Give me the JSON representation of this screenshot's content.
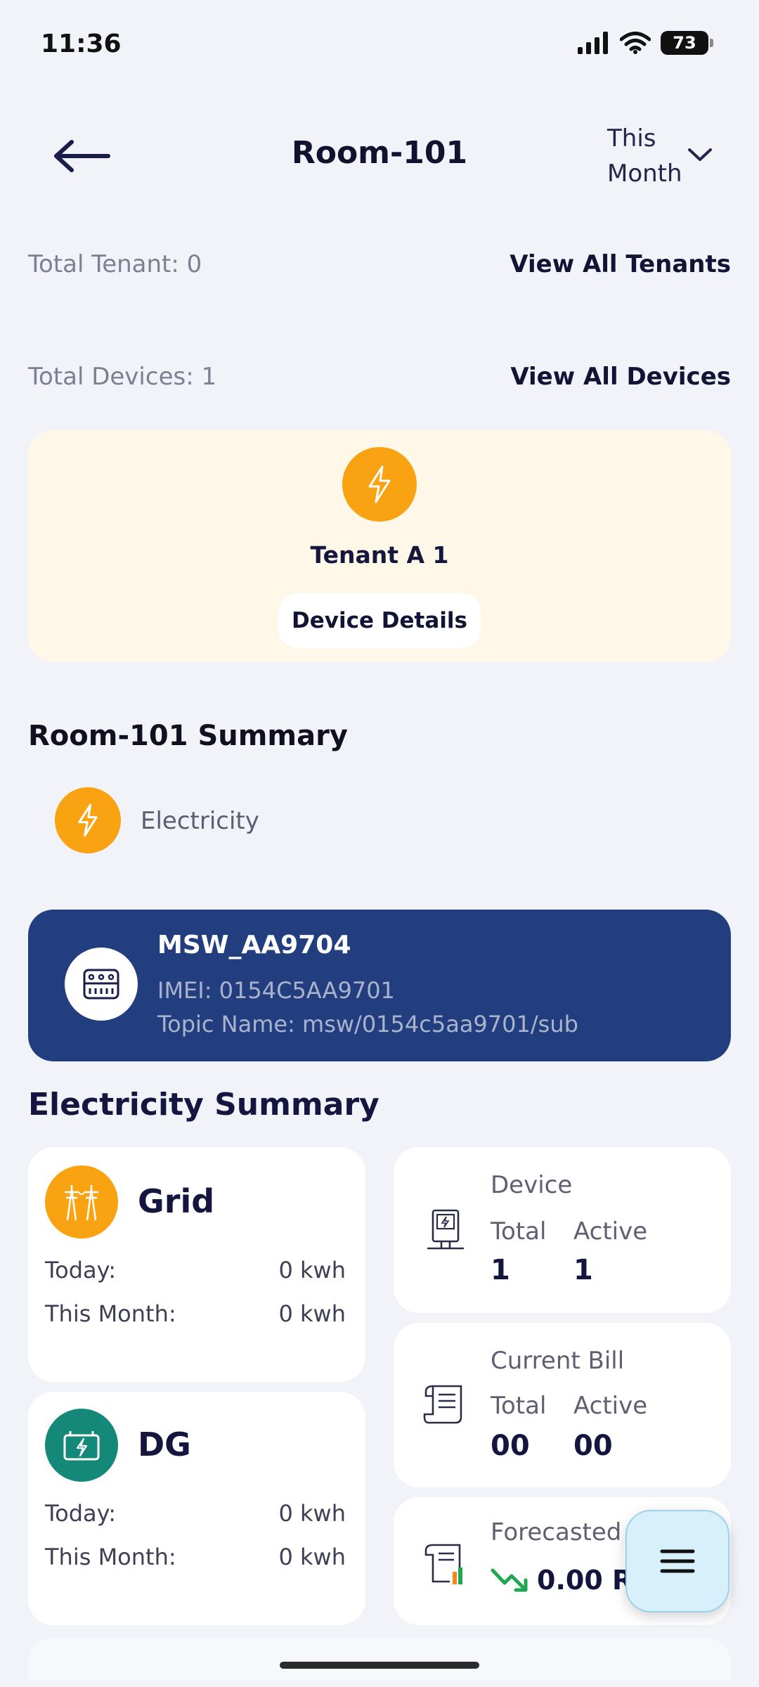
{
  "status": {
    "time": "11:36",
    "battery": "73"
  },
  "header": {
    "title": "Room-101",
    "period_line1": "This",
    "period_line2": "Month"
  },
  "tenants": {
    "label": "Total Tenant: 0",
    "link": "View All Tenants"
  },
  "devices": {
    "label": "Total Devices: 1",
    "link": "View All Devices"
  },
  "tenant_card": {
    "name": "Tenant A 1",
    "button": "Device Details"
  },
  "summary": {
    "title": "Room-101 Summary",
    "utility": "Electricity"
  },
  "device": {
    "name": "MSW_AA9704",
    "imei": "IMEI: 0154C5AA9701",
    "topic": "Topic Name: msw/0154c5aa9701/sub"
  },
  "electricity": {
    "title": "Electricity Summary",
    "grid": {
      "title": "Grid",
      "today_label": "Today:",
      "today_value": "0 kwh",
      "month_label": "This Month:",
      "month_value": "0 kwh"
    },
    "dg": {
      "title": "DG",
      "today_label": "Today:",
      "today_value": "0 kwh",
      "month_label": "This Month:",
      "month_value": "0 kwh"
    },
    "device_stat": {
      "title": "Device",
      "total_label": "Total",
      "active_label": "Active",
      "total": "1",
      "active": "1"
    },
    "bill_stat": {
      "title": "Current Bill",
      "total_label": "Total",
      "active_label": "Active",
      "total": "00",
      "active": "00"
    },
    "forecast": {
      "title": "Forecasted",
      "value": "0.00 R"
    }
  },
  "colors": {
    "accent_orange": "#f9a312",
    "dg_green": "#14897a",
    "banner_blue": "#223e7f",
    "card_cream": "#fff7e8"
  }
}
